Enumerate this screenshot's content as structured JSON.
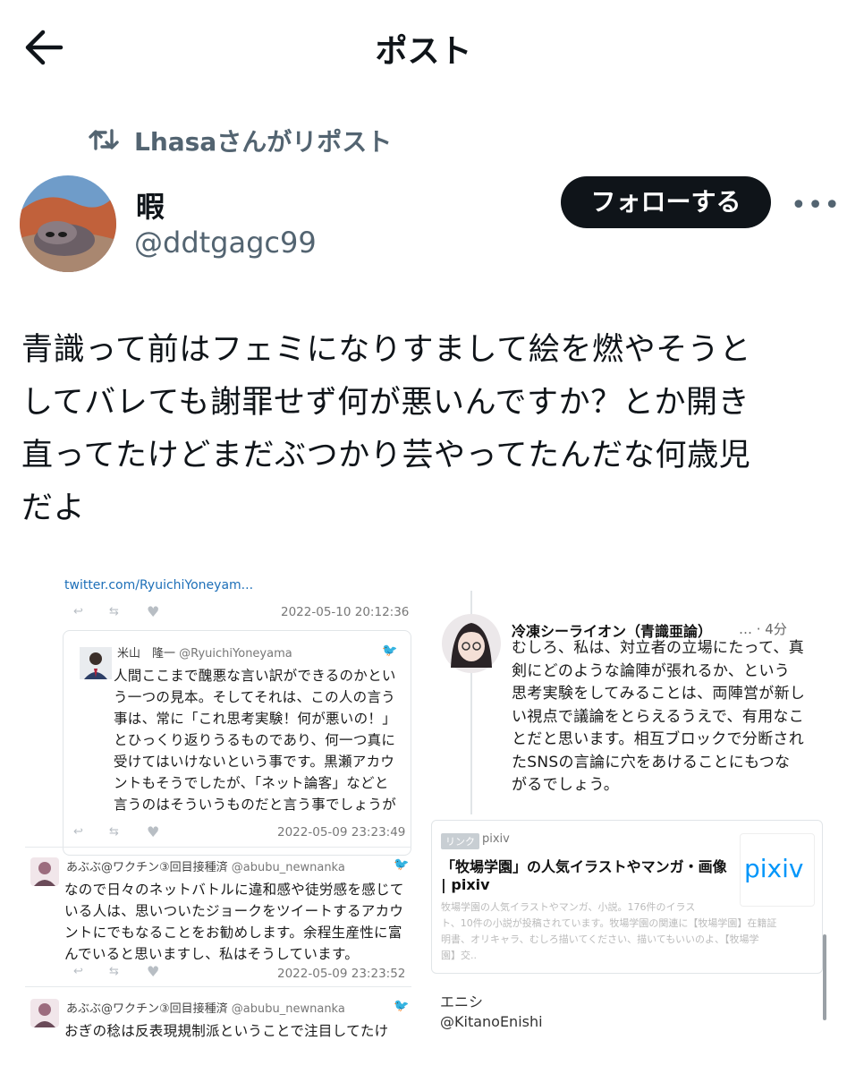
{
  "header": {
    "title": "ポスト"
  },
  "repost": {
    "label": "Lhasaさんがリポスト"
  },
  "author": {
    "display_name": "暇",
    "handle": "@ddtgagc99"
  },
  "follow": {
    "label": "フォローする"
  },
  "more": {
    "label": "•••"
  },
  "post": {
    "lines": [
      "青識って前はフェミになりすまして絵を燃やそうと",
      "してバレても謝罪せず何が悪いんですか？とか開き",
      "直ってたけどまだぶつかり芸やってたんだな何歳児",
      "だよ"
    ]
  },
  "screenshot": {
    "top_link": "twitter.com/RyuichiYoneyam...",
    "ts1": "2022-05-10 20:12:36",
    "quote": {
      "name": "米山　隆一",
      "handle": "@RyuichiYoneyama",
      "lines": [
        "人間ここまで醜悪な言い訳ができるのかとい",
        "う一つの見本。そしてそれは、この人の言う",
        "事は、常に「これ思考実験！何が悪いの！」",
        "とひっくり返りうるものであり、何一つ真に",
        "受けてはいけないという事です。黒瀬アカウ",
        "ントもそうでしたが、「ネット論客」などと",
        "言うのはそういうものだと言う事でしょうが"
      ]
    },
    "ts2": "2022-05-09 23:23:49",
    "reply1": {
      "name": "あぶぶ@ワクチン③回目接種済",
      "handle": "@abubu_newnanka",
      "lines": [
        "なので日々のネットバトルに違和感や徒労感を感じて",
        "いる人は、思いついたジョークをツイートするアカウ",
        "ントにでもなることをお勧めします。余程生産性に富",
        "んでいると思いますし、私はそうしています。"
      ]
    },
    "ts3": "2022-05-09 23:23:52",
    "reply2": {
      "name": "あぶぶ@ワクチン③回目接種済",
      "handle": "@abubu_newnanka",
      "line": "おぎの稔は反表現規制派ということで注目してたけ"
    },
    "right": {
      "name": "冷凍シーライオン（青識亜論）",
      "time": "… · 4分",
      "lines": [
        "むしろ、私は、対立者の立場にたって、真",
        "剣にどのような論陣が張れるか、という",
        "思考実験をしてみることは、両陣営が新し",
        "い視点で議論をとらえるうえで、有用なこ",
        "とだと思います。相互ブロックで分断され",
        "たSNSの言論に穴をあけることにもつな",
        "がるでしょう。"
      ]
    },
    "link_card": {
      "tag": "リンク",
      "site": "pixiv",
      "title1": "「牧場学園」の人気イラストやマンガ・画像",
      "title2": "| pixiv",
      "desc1": "牧場学園の人気イラストやマンガ、小説。176件のイラス",
      "desc2": "ト、10件の小説が投稿されています。牧場学園の関連に【牧場学園】在籍証",
      "desc3": "明書、オリキャラ、むしろ描いてください、描いてもいいのよ、【牧場学",
      "desc4": "園】交..",
      "logo": "pixiv"
    },
    "enishi": {
      "name": "エニシ",
      "handle": "@KitanoEnishi"
    }
  }
}
